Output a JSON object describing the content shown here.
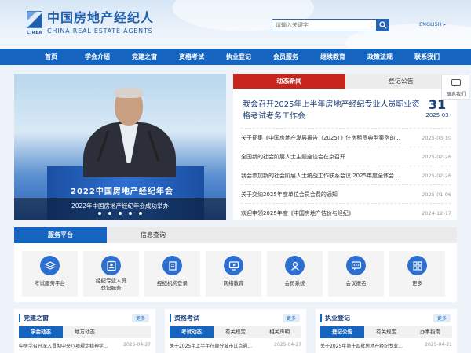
{
  "header": {
    "logo_abbr": "CIREA",
    "logo_cn": "中国房地产经纪人",
    "logo_en": "CHINA REAL ESTATE AGENTS",
    "search_placeholder": "请输入关键字",
    "lang_label": "ENGLISH ▸"
  },
  "nav": {
    "items": [
      "首页",
      "学会介绍",
      "党建之窗",
      "资格考试",
      "执业登记",
      "会员服务",
      "继续教育",
      "政策法规",
      "联系我们"
    ]
  },
  "hero": {
    "stage_title": "2022中国房地产经纪年会",
    "caption": "2022年中国房地产经纪年会成功举办",
    "slide_count": 5
  },
  "news": {
    "tabs": [
      "动态新闻",
      "登记公告"
    ],
    "headline": "我会召开2025年上半年房地产经纪专业人员职业资格考试考务工作会",
    "headline_day": "31",
    "headline_ym": "2025-03",
    "items": [
      {
        "title": "关于征集《中国房地产发展报告（2025）》住房租赁典型案例的...",
        "date": "2025-03-10"
      },
      {
        "title": "全国新的社会阶层人士主题座谈会在京召开",
        "date": "2025-02-26"
      },
      {
        "title": "我会参加新的社会阶层人士统战工作联系会议 2025年度全体会...",
        "date": "2025-02-26"
      },
      {
        "title": "关于交纳2025年度单位会员会费的通知",
        "date": "2025-01-06"
      },
      {
        "title": "欢迎申领2025年度《中国房地产估价与经纪》",
        "date": "2024-12-17"
      }
    ]
  },
  "contact": {
    "label": "联系我们"
  },
  "services": {
    "tabs": [
      "服务平台",
      "信息查询"
    ],
    "items": [
      {
        "label": "考试服务平台",
        "icon": "layers-icon"
      },
      {
        "label": "经纪专业人员\n登记服务",
        "icon": "id-card-icon"
      },
      {
        "label": "经纪机构登录",
        "icon": "building-icon"
      },
      {
        "label": "网络教育",
        "icon": "monitor-icon"
      },
      {
        "label": "会员系统",
        "icon": "user-icon"
      },
      {
        "label": "会议报名",
        "icon": "chat-icon"
      },
      {
        "label": "更多",
        "icon": "grid-icon"
      }
    ]
  },
  "panels": [
    {
      "title": "党建之窗",
      "more": "更多",
      "tabs": [
        "学会动态",
        "地方动态"
      ],
      "row": {
        "title": "中房学召开深入贯彻中央八项规定精神学...",
        "date": "2025-04-27"
      }
    },
    {
      "title": "资格考试",
      "more": "更多",
      "tabs": [
        "考试动态",
        "有关规定",
        "相关声明"
      ],
      "row": {
        "title": "关于2025年上半年在部分城市试点通...",
        "date": "2025-04-27"
      }
    },
    {
      "title": "执业登记",
      "more": "更多",
      "tabs": [
        "登记公告",
        "有关规定",
        "办事指南"
      ],
      "row": {
        "title": "关于2025年第十四批房地产经纪专业...",
        "date": "2025-04-21"
      }
    }
  ],
  "colors": {
    "nav_blue": "#1565c0",
    "accent_red": "#c8261d",
    "brand_blue": "#1f5fae"
  }
}
